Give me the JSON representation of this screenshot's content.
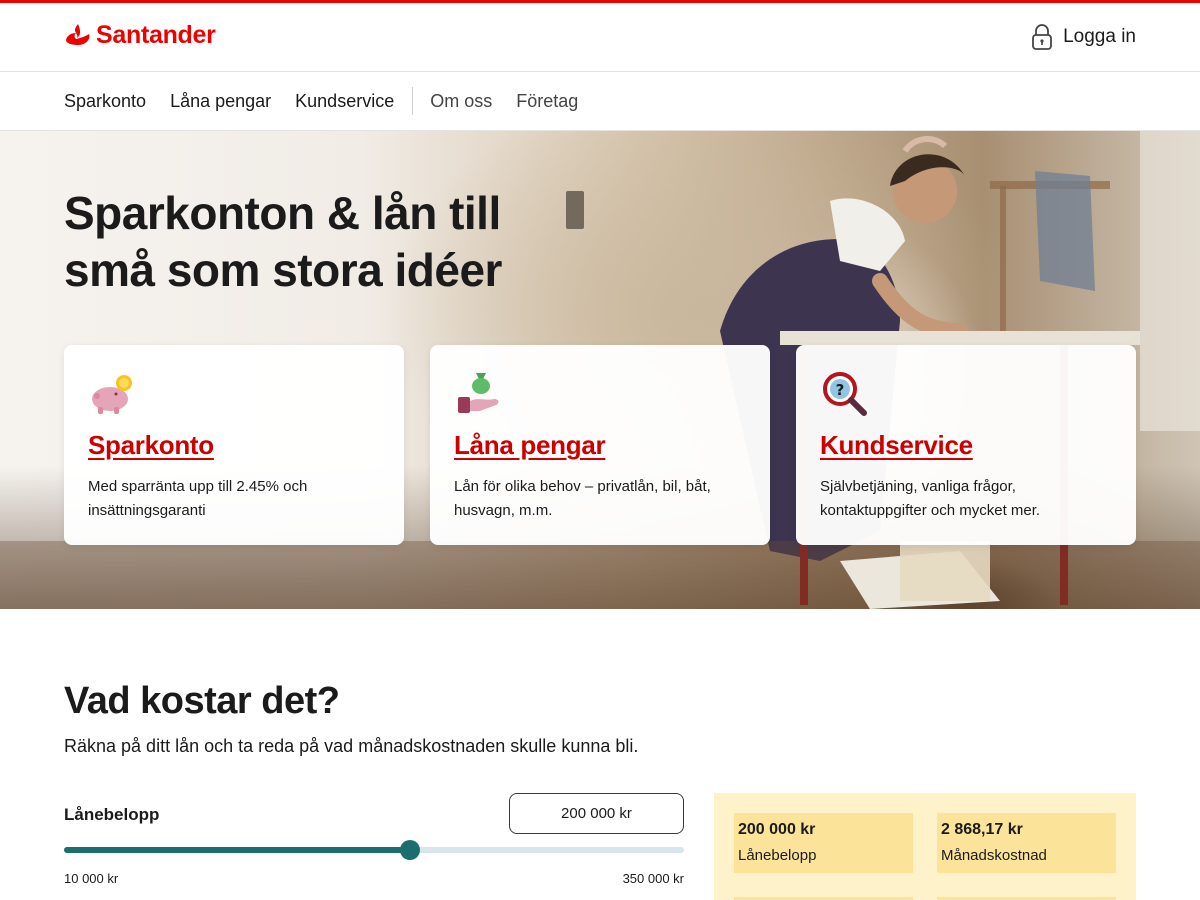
{
  "brand": {
    "name": "Santander",
    "color": "#ec0000"
  },
  "header": {
    "login_label": "Logga in",
    "login_icon": "lock-icon"
  },
  "nav": {
    "primary": [
      {
        "label": "Sparkonto"
      },
      {
        "label": "Låna pengar"
      },
      {
        "label": "Kundservice"
      }
    ],
    "secondary": [
      {
        "label": "Om oss"
      },
      {
        "label": "Företag"
      }
    ]
  },
  "hero": {
    "title_line1": "Sparkonton & lån till",
    "title_line2": "små som stora idéer",
    "cards": [
      {
        "icon": "piggy-bank-icon",
        "title": "Sparkonto",
        "text": "Med sparränta upp till 2.45% och insättningsgaranti"
      },
      {
        "icon": "money-bag-hand-icon",
        "title": "Låna pengar",
        "text": "Lån för olika behov – privatlån, bil, båt, husvagn, m.m."
      },
      {
        "icon": "magnifier-question-icon",
        "title": "Kundservice",
        "text": "Självbetjäning, vanliga frågor, kontaktuppgifter och mycket mer."
      }
    ]
  },
  "calculator": {
    "title": "Vad kostar det?",
    "subtitle": "Räkna på ditt lån och ta reda på vad månadskostnaden skulle kunna bli.",
    "amount_label": "Lånebelopp",
    "amount_value": "200 000 kr",
    "slider": {
      "min_label": "10 000 kr",
      "max_label": "350 000 kr",
      "min": 10000,
      "max": 350000,
      "value": 200000
    },
    "summary": {
      "loan_value": "200 000 kr",
      "loan_label": "Lånebelopp",
      "monthly_value": "2 868,17 kr",
      "monthly_label": "Månadskostnad"
    }
  },
  "colors": {
    "accent_red": "#cc0000",
    "slider_teal": "#1b6d70",
    "summary_bg": "#fdf2c9",
    "summary_box": "#fbe49a"
  }
}
